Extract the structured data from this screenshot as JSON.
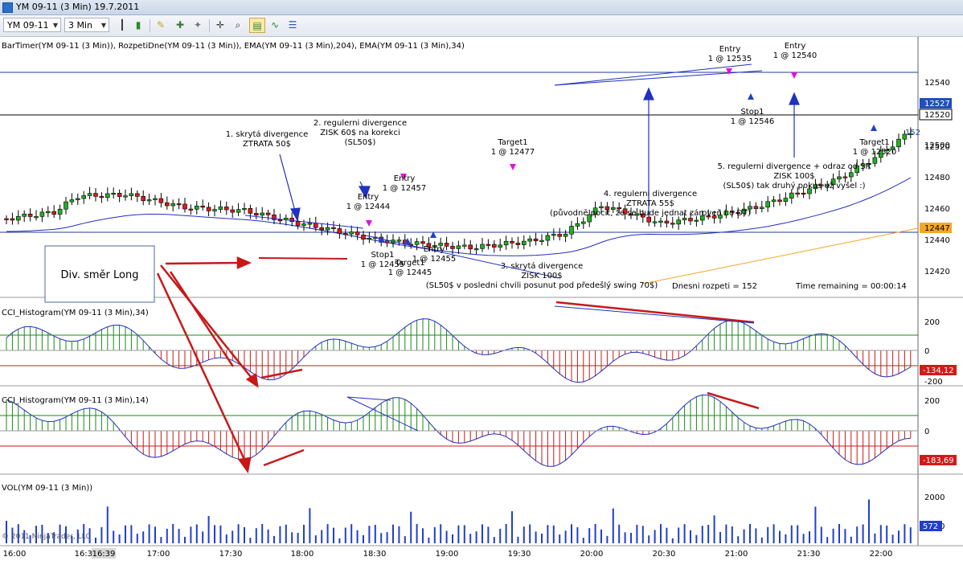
{
  "window": {
    "title": "YM 09-11 (3 Min)  19.7.2011",
    "instrument": "YM 09-11",
    "interval": "3 Min"
  },
  "icons": [
    "chart-icon",
    "dropdown-arrow-icon",
    "bar-chart-icon",
    "candlestick-icon",
    "pencil-icon",
    "add-indicator-icon",
    "properties-icon",
    "crosshair-icon",
    "zoom-icon",
    "panel-icon",
    "line-chart-icon",
    "sliders-icon"
  ],
  "main": {
    "indicators_label": "BarTimer(YM 09-11 (3 Min)), RozpetiDne(YM 09-11 (3 Min)), EMA(YM 09-11 (3 Min),204), EMA(YM 09-11 (3 Min),34)",
    "price_ticks": [
      "12540",
      "12520",
      "12500",
      "12480",
      "12460",
      "12440",
      "12420"
    ],
    "price_badges": [
      {
        "text": "12527",
        "color": "#1f4fb8"
      },
      {
        "text": "12520",
        "color": "#ffffff"
      },
      {
        "text": "12447",
        "color": "#f5a623"
      }
    ],
    "partial_label": "152",
    "annotations": {
      "ann1": [
        "1. skrytá divergence",
        "ZTRATA 50$"
      ],
      "ann2": [
        "2. regulerni divergence",
        "ZISK 60$ na korekci",
        "(SL50$)"
      ],
      "ann3": [
        "3. skrytá divergence",
        "ZISK 100$",
        "(SL50$ v posledni chvili posunut pod předešlý swing 70$)"
      ],
      "ann4": [
        "4. regulerni divergence",
        "ZTRATA 55$",
        "(původně pocit, že se bude jednat zároveň i o DT)"
      ],
      "ann5": [
        "5. regulerni divergence + odraz od SR",
        "ZISK 100$",
        "(SL50$) tak druhý pokus už vyšel :)"
      ]
    },
    "orders": [
      [
        "Entry",
        "1 @ 12444"
      ],
      [
        "Entry",
        "1 @ 12457"
      ],
      [
        "Stop1",
        "1 @ 12455"
      ],
      [
        "Entry",
        "1 @ 12455"
      ],
      [
        "Target1",
        "1 @ 12445"
      ],
      [
        "Target1",
        "1 @ 12477"
      ],
      [
        "Entry",
        "1 @ 12535"
      ],
      [
        "Entry",
        "1 @ 12540"
      ],
      [
        "Stop1",
        "1 @ 12546"
      ],
      [
        "Target1",
        "1 @ 12520"
      ]
    ],
    "callout": "Div. směr Long",
    "daily_range": "Dnesni rozpeti = 152",
    "time_remaining": "Time remaining = 00:00:14"
  },
  "panels": [
    {
      "label": "CCI_Histogram(YM 09-11 (3 Min),34)",
      "ticks": [
        "200",
        "0",
        "-200"
      ],
      "badge": "-134,12"
    },
    {
      "label": "CCI_Histogram(YM 09-11 (3 Min),14)",
      "ticks": [
        "200",
        "0"
      ],
      "badge": "-183,69"
    },
    {
      "label": "VOL(YM 09-11 (3 Min))",
      "ticks": [
        "2000",
        "1000"
      ],
      "badge": "572"
    }
  ],
  "x_axis": {
    "labels": [
      "16:00",
      "16:30",
      "17:00",
      "17:30",
      "18:00",
      "18:30",
      "19:00",
      "19:30",
      "20:00",
      "20:30",
      "21:00",
      "21:30",
      "22:00"
    ],
    "cursor_time": "16:39"
  },
  "copyright": "© 2011 NinjaTrader, LLC"
}
